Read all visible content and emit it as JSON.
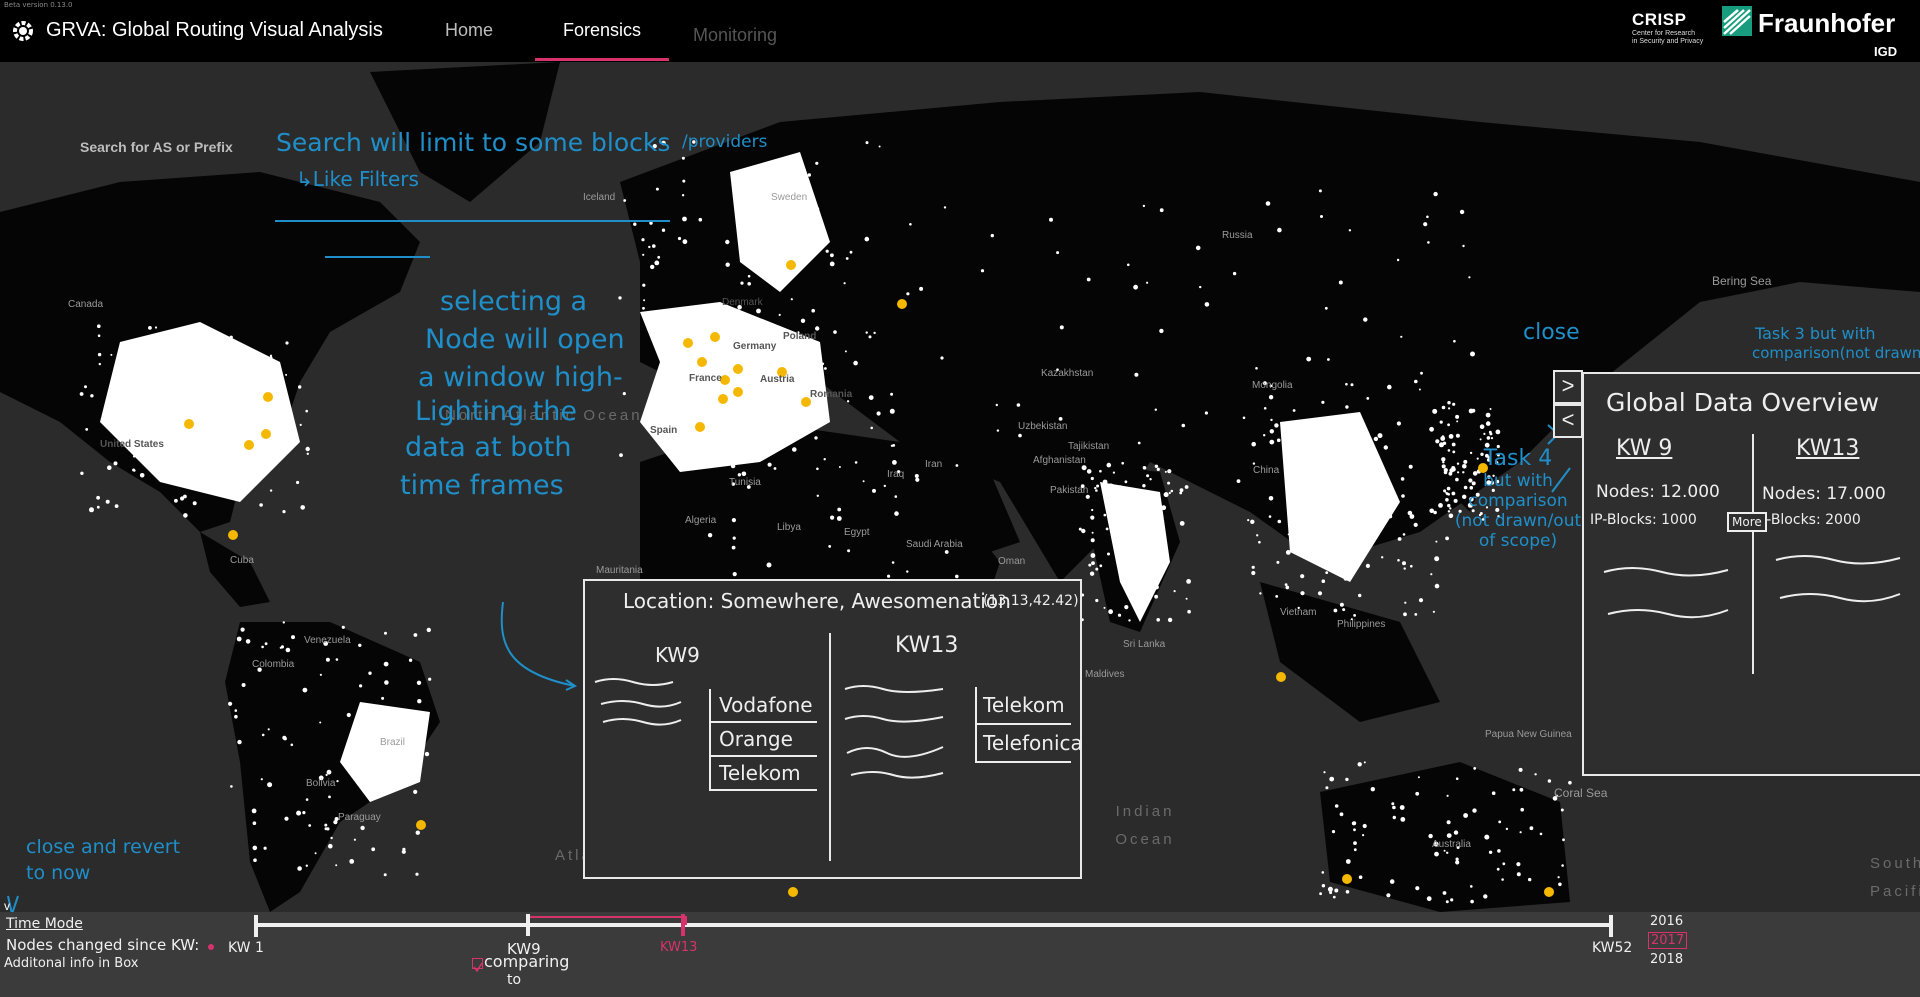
{
  "header": {
    "beta": "Beta version 0.13.0",
    "title": "GRVA: Global Routing Visual Analysis",
    "tabs": [
      {
        "label": "Home",
        "state": "default"
      },
      {
        "label": "Forensics",
        "state": "active"
      },
      {
        "label": "Monitoring",
        "state": "disabled"
      }
    ],
    "crisp": {
      "name": "CRISP",
      "line1": "Center for Research",
      "line2": "in Security and Privacy"
    },
    "fraunhofer": {
      "name": "Fraunhofer",
      "unit": "IGD"
    }
  },
  "search": {
    "placeholder": "Search for AS or Prefix"
  },
  "map": {
    "countries": [
      "Iceland",
      "Sweden",
      "Russia",
      "Canada",
      "United States",
      "Germany",
      "Poland",
      "France",
      "Austria",
      "Romania",
      "Spain",
      "Kazakhstan",
      "Mongolia",
      "Uzbekistan",
      "Tajikistan",
      "Afghanistan",
      "Iran",
      "Iraq",
      "Pakistan",
      "China",
      "Tunisia",
      "Algeria",
      "Libya",
      "Egypt",
      "Saudi Arabia",
      "Oman",
      "Mauritania",
      "Cuba",
      "Venezuela",
      "Colombia",
      "Brazil",
      "Bolivia",
      "Paraguay",
      "Maldives",
      "Sri Lanka",
      "Vietnam",
      "Philippines",
      "Papua New Guinea",
      "Australia",
      "Denmark"
    ],
    "oceans": {
      "atlantic": "North Atlantic Ocean",
      "atlantic_south": "Atlantic Ocean",
      "indian": "Indian Ocean",
      "bering": "Bering Sea",
      "coral": "Coral Sea",
      "pacific": "South Pacific"
    },
    "colors": {
      "land": "#050505",
      "ocean": "#2b2b2b",
      "node": "#ffffff",
      "highlight": "#f5b800",
      "annotation": "#1f8fc9",
      "accent": "#d6336c"
    }
  },
  "annotations": {
    "search_note": "Search will limit to some blocks",
    "search_note2": "/providers",
    "filters_note": "↳Like Filters",
    "node_note": [
      "selecting a",
      "Node will open",
      "a window high-",
      "Lighting the",
      "data at both",
      "time frames"
    ],
    "close_note": "close",
    "task3_note": [
      "Task 3 but with",
      "comparison(not drawn)"
    ],
    "task4_note": [
      "Task 4",
      "but with",
      "comparison",
      "(not drawn/out",
      "of scope)"
    ],
    "revert_note": [
      "close and revert",
      "to now"
    ]
  },
  "location_panel": {
    "title": "Location: Somewhere, Awesomenation",
    "coords": "(13.13,42.42)",
    "left_header": "KW9",
    "right_header": "KW13",
    "left_providers": [
      "Vodafone",
      "Orange",
      "Telekom"
    ],
    "right_providers": [
      "Telekom",
      "Telefonica"
    ]
  },
  "overview_panel": {
    "title": "Global Data Overview",
    "left_header": "KW 9",
    "right_header": "KW13",
    "left_nodes": "Nodes: 12.000",
    "left_blocks": "IP-Blocks: 1000",
    "right_nodes": "Nodes: 17.000",
    "right_blocks": "IP-Blocks: 2000",
    "more_label": "More",
    "close_label": ">",
    "open_label": "<"
  },
  "timeline": {
    "time_mode": "Time Mode",
    "changed": "Nodes changed since KW:",
    "additional": "Additonal info in Box",
    "start": "KW 1",
    "mid": "KW9",
    "selected": "KW13",
    "end": "KW52",
    "comparing": "comparing",
    "to": "to",
    "years": [
      "2016",
      "2017",
      "2018"
    ],
    "collapse": "v"
  }
}
